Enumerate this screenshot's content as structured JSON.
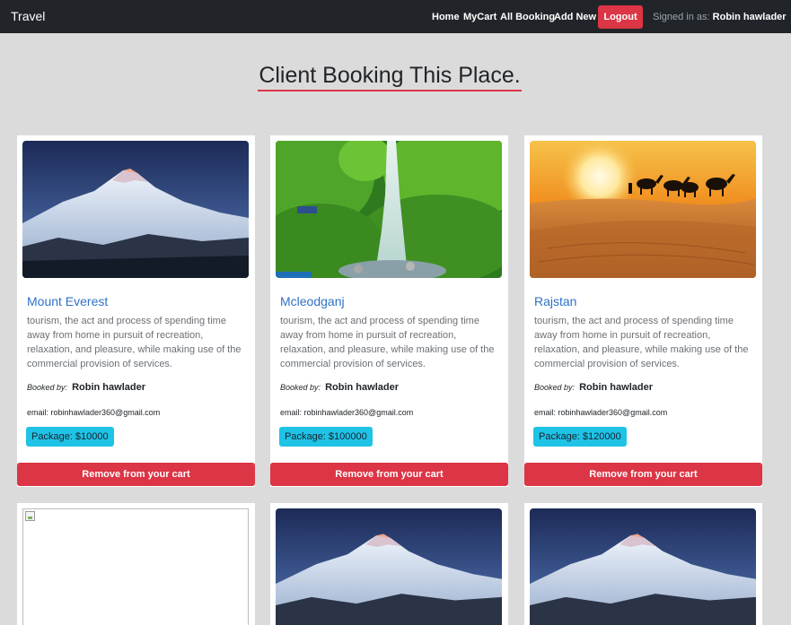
{
  "navbar": {
    "brand": "Travel",
    "links": [
      "Home",
      "MyCart",
      "All Booking",
      "Add New"
    ],
    "logout": "Logout",
    "signed_in_label": "Signed in as:",
    "signed_in_user": "Robin hawlader"
  },
  "heading": "Client Booking This Place.",
  "cards": [
    {
      "title": "Mount Everest",
      "image": "mountain-photo",
      "description": "tourism, the act and process of spending time away from home in pursuit of recreation, relaxation, and pleasure, while making use of the commercial provision of services.",
      "booked_by_label": "Booked by:",
      "booked_by": "Robin hawlader",
      "email": "email: robinhawlader360@gmail.com",
      "package": "Package: $10000",
      "remove_label": "Remove from your cart"
    },
    {
      "title": "Mcleodganj",
      "image": "waterfall-photo",
      "description": "tourism, the act and process of spending time away from home in pursuit of recreation, relaxation, and pleasure, while making use of the commercial provision of services.",
      "booked_by_label": "Booked by:",
      "booked_by": "Robin hawlader",
      "email": "email: robinhawlader360@gmail.com",
      "package": "Package: $100000",
      "remove_label": "Remove from your cart"
    },
    {
      "title": "Rajstan",
      "image": "desert-camels-photo",
      "description": "tourism, the act and process of spending time away from home in pursuit of recreation, relaxation, and pleasure, while making use of the commercial provision of services.",
      "booked_by_label": "Booked by:",
      "booked_by": "Robin hawlader",
      "email": "email: robinhawlader360@gmail.com",
      "package": "Package: $120000",
      "remove_label": "Remove from your cart"
    }
  ],
  "second_row_images": [
    "broken-image-icon",
    "mountain-photo",
    "mountain-photo"
  ],
  "colors": {
    "navbar": "#212529",
    "accent_red": "#dc3545",
    "package_badge": "#1fc3e6",
    "title_link": "#2f72c6",
    "page_bg": "#dbdbdb"
  }
}
